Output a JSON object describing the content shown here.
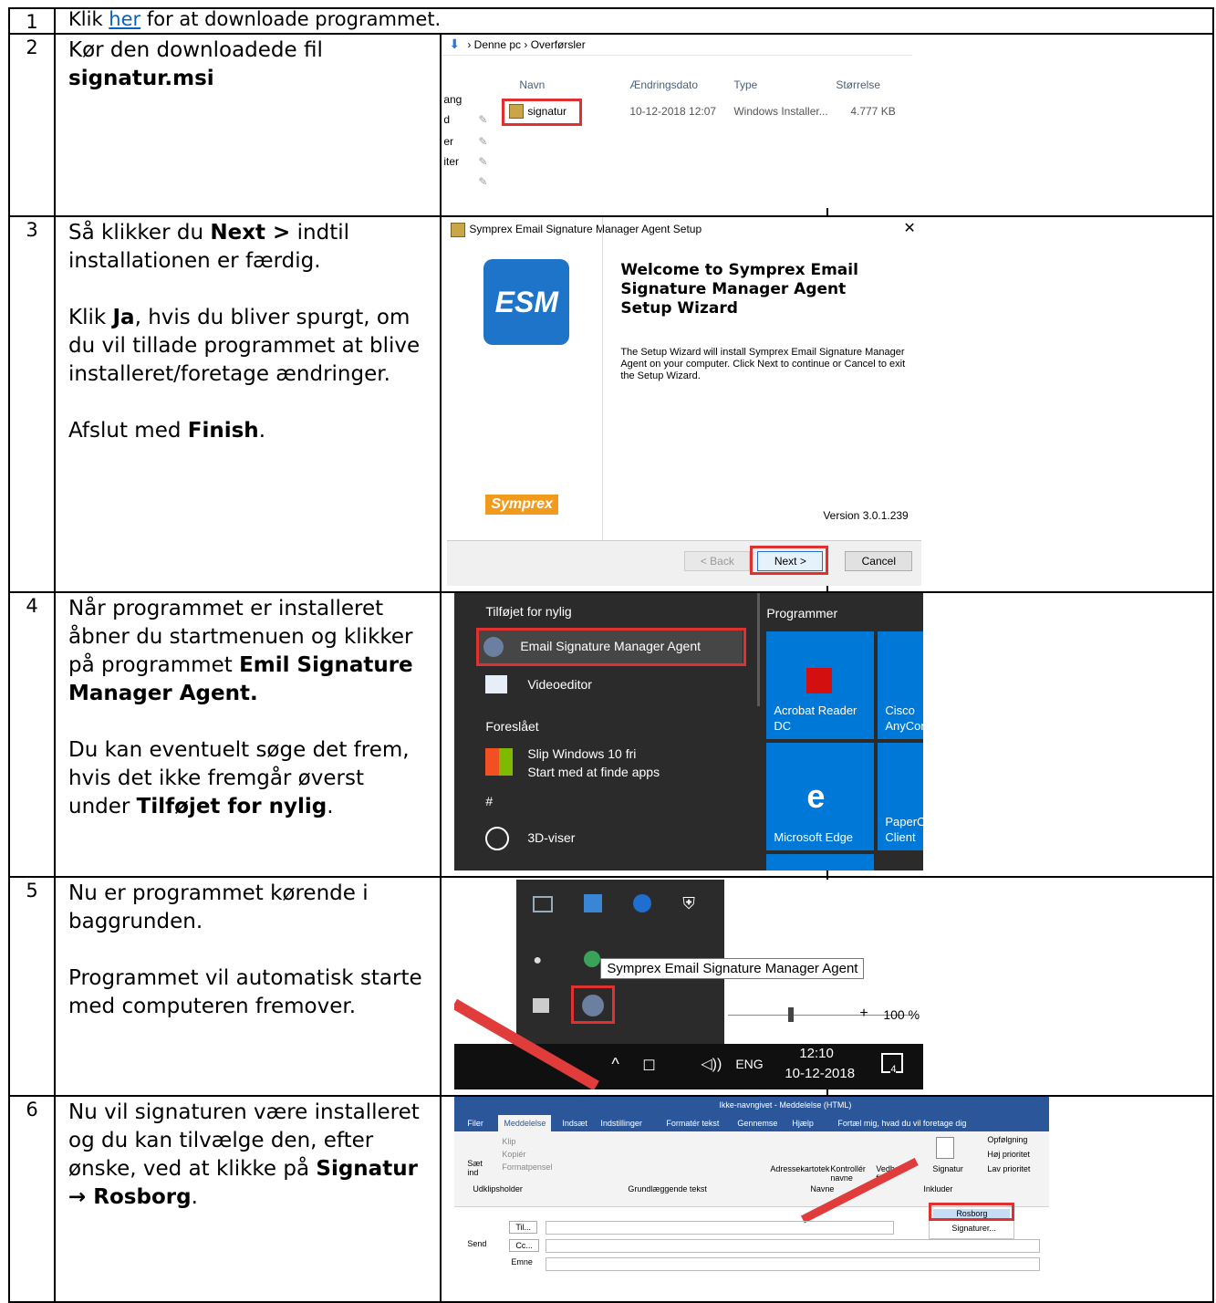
{
  "rows": [
    {
      "num": "1",
      "pre": "Klik ",
      "link": "her",
      "post": " for at downloade programmet."
    },
    {
      "num": "2",
      "line1": "Kør den downloadede fil",
      "bold": "signatur.msi"
    },
    {
      "num": "3",
      "p1a": "Så klikker du ",
      "p1b": "Next >",
      "p1c": " indtil installationen er færdig.",
      "p2a": "Klik ",
      "p2b": "Ja",
      "p2c": ", hvis du bliver spurgt, om du vil tillade programmet at blive installeret/foretage ændringer.",
      "p3a": "Afslut med ",
      "p3b": "Finish",
      "p3c": "."
    },
    {
      "num": "4",
      "p1a": "Når programmet er installeret åbner du startmenuen og klikker på programmet ",
      "p1b": "Emil Signature Manager Agent.",
      "p2a": "Du kan eventuelt søge det frem, hvis det ikke fremgår øverst under ",
      "p2b": "Tilføjet for nylig",
      "p2c": "."
    },
    {
      "num": "5",
      "p1": "Nu er programmet kørende i baggrunden.",
      "p2": "Programmet vil automatisk starte med computeren fremover."
    },
    {
      "num": "6",
      "p1a": "Nu vil signaturen være installeret og du kan tilvælge den, efter ønske, ved at klikke på ",
      "p1b": "Signatur",
      "arrow": "→ ",
      "p1c": "Rosborg",
      "p1d": "."
    }
  ],
  "explorer": {
    "crumb1": "Denne pc",
    "crumb2": "Overførsler",
    "col_name": "Navn",
    "col_date": "Ændringsdato",
    "col_type": "Type",
    "col_size": "Størrelse",
    "file": "signatur",
    "date": "10-12-2018 12:07",
    "type": "Windows Installer...",
    "size": "4.777 KB",
    "side": [
      "ang",
      "d",
      "er",
      "iter"
    ]
  },
  "setup": {
    "title": "Symprex Email Signature Manager Agent Setup",
    "logo": "ESM",
    "heading": "Welcome to Symprex Email Signature Manager Agent Setup Wizard",
    "body": "The Setup Wizard will install Symprex Email Signature Manager Agent on your computer.  Click Next to continue or Cancel to exit the Setup Wizard.",
    "brand": "Symprex",
    "version": "Version 3.0.1.239",
    "back": "< Back",
    "next": "Next >",
    "cancel": "Cancel"
  },
  "start": {
    "recent": "Tilføjet for nylig",
    "app1": "Email Signature Manager Agent",
    "app2": "Videoeditor",
    "suggested": "Foreslået",
    "sug1": "Slip Windows 10 fri",
    "sug2": "Start med at finde apps",
    "hash": "#",
    "app3": "3D-viser",
    "programs": "Programmer",
    "tile1": "Acrobat Reader DC",
    "tile2": "Cisco AnyConn",
    "tile3": "Microsoft Edge",
    "tile4": "PaperCut Client"
  },
  "tray": {
    "tooltip": "Symprex Email Signature Manager Agent",
    "zoom": "100 %",
    "lang": "ENG",
    "time": "12:10",
    "date": "10-12-2018",
    "badge": "4"
  },
  "outlook": {
    "title": "Ikke-navngivet - Meddelelse (HTML)",
    "tabs": [
      "Filer",
      "Meddelelse",
      "Indsæt",
      "Indstillinger",
      "Formatér tekst",
      "Gennemse",
      "Hjælp"
    ],
    "tell": "Fortæl mig, hvad du vil foretage dig",
    "grp1": "Udklipsholder",
    "grp2": "Grundlæggende tekst",
    "grp3": "Navne",
    "grp4": "Inkluder",
    "b_addr": "Adressekartotek",
    "b_check": "Kontrollér navne",
    "b_attach": "Vedhæft fil",
    "b_sig": "Signatur",
    "f1": "Opfølgning",
    "f2": "Høj prioritet",
    "f3": "Lav prioritet",
    "menu1": "Rosborg",
    "menu2": "Signaturer...",
    "to": "Til...",
    "cc": "Cc...",
    "subject": "Emne",
    "send": "Send",
    "paste": "Sæt ind",
    "cut": "Klip",
    "copy": "Kopiér",
    "fmt": "Formatpensel"
  }
}
